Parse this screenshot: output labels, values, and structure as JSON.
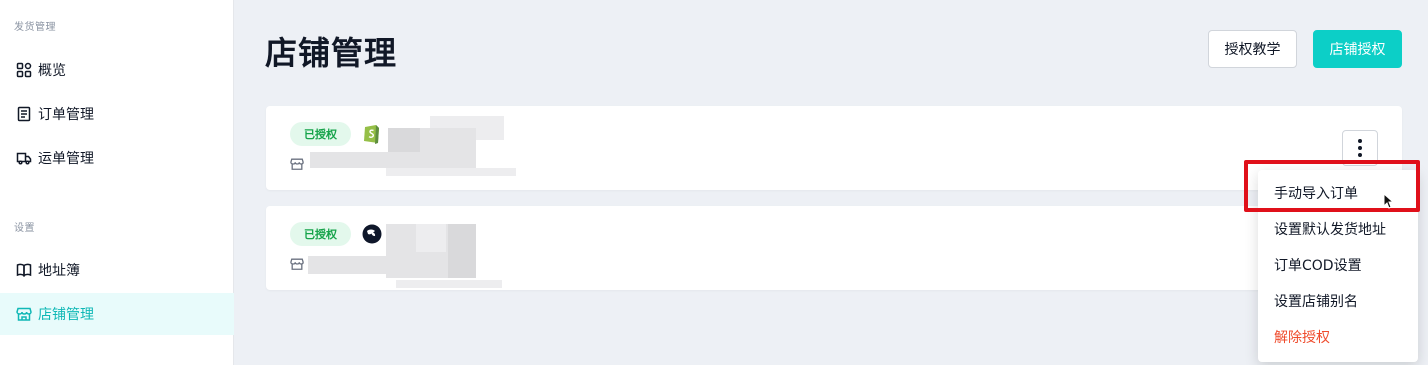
{
  "sidebar": {
    "sections": [
      {
        "title": "发货管理"
      },
      {
        "title": "设置"
      }
    ],
    "items": [
      {
        "label": "概览",
        "icon": "grid-icon"
      },
      {
        "label": "订单管理",
        "icon": "clipboard-icon"
      },
      {
        "label": "运单管理",
        "icon": "truck-icon"
      },
      {
        "label": "地址簿",
        "icon": "book-icon"
      },
      {
        "label": "店铺管理",
        "icon": "store-icon",
        "active": true
      }
    ]
  },
  "header": {
    "title": "店铺管理",
    "tutorial_label": "授权教学",
    "authorize_label": "店铺授权"
  },
  "stores": [
    {
      "status": "已授权",
      "platform_icon": "shopify-icon"
    },
    {
      "status": "已授权",
      "platform_icon": "shopline-icon"
    }
  ],
  "menu": {
    "items": [
      {
        "label": "手动导入订单"
      },
      {
        "label": "设置默认发货地址"
      },
      {
        "label": "订单COD设置"
      },
      {
        "label": "设置店铺别名"
      },
      {
        "label": "解除授权",
        "danger": true
      }
    ]
  },
  "colors": {
    "accent": "#0ccfc7",
    "active_bg": "#e8fbfb",
    "badge_bg": "#e3f8ec",
    "badge_text": "#16a34a",
    "danger": "#ef4b2c",
    "highlight": "#e0101a"
  }
}
